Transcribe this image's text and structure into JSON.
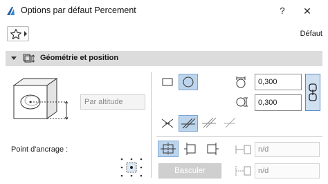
{
  "window": {
    "title": "Options par défaut Percement",
    "help_label": "?",
    "close_label": "✕"
  },
  "toolbar": {
    "favorites_icon": "star-icon",
    "preset_label": "Défaut"
  },
  "section": {
    "title": "Géométrie et position",
    "icon": "geometry-position-icon"
  },
  "left_panel": {
    "altitude_button": "Par altitude",
    "anchor_label": "Point d'ancrage :"
  },
  "right_panel": {
    "shapes": [
      {
        "name": "rectangular-shape",
        "selected": false
      },
      {
        "name": "circular-shape",
        "selected": true
      }
    ],
    "dimension1_value": "0,300",
    "dimension2_value": "0,300",
    "link_dimensions_active": true,
    "cut_options": [
      {
        "name": "cut-option-1",
        "selected": false
      },
      {
        "name": "cut-option-2",
        "selected": true
      },
      {
        "name": "cut-option-3",
        "selected": false
      },
      {
        "name": "cut-option-4",
        "selected": false
      }
    ],
    "alignment_options": [
      {
        "name": "align-center",
        "selected": true
      },
      {
        "name": "align-left",
        "selected": false
      },
      {
        "name": "align-right",
        "selected": false
      }
    ],
    "flip_button": "Basculer",
    "nd1_value": "n/d",
    "nd2_value": "n/d"
  },
  "colors": {
    "selected_fill": "#bcd4ec",
    "selected_border": "#7aa6d4",
    "section_bg": "#dcdcdc"
  }
}
